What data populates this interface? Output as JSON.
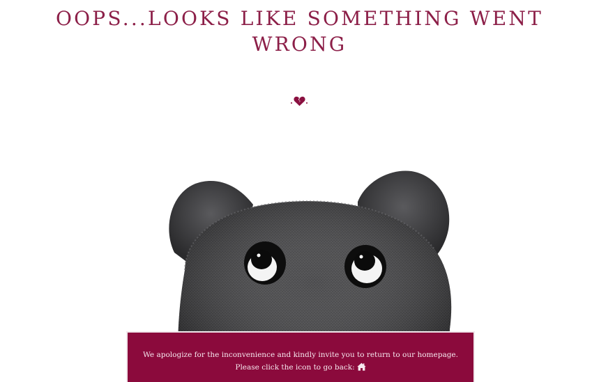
{
  "error": {
    "title": "OOPS...LOOKS LIKE SOMETHING WENT WRONG",
    "message_line1": "We apologize for the inconvenience and kindly invite you to return to our homepage.",
    "message_line2": "Please click the icon to go back:"
  },
  "icons": {
    "divider": "broken-heart-icon",
    "back": "home-icon",
    "illustration": "plush-bear"
  },
  "colors": {
    "accent": "#8b0a3c",
    "title": "#8c1f48",
    "banner_text": "#f6e7ee",
    "background": "#ffffff"
  }
}
